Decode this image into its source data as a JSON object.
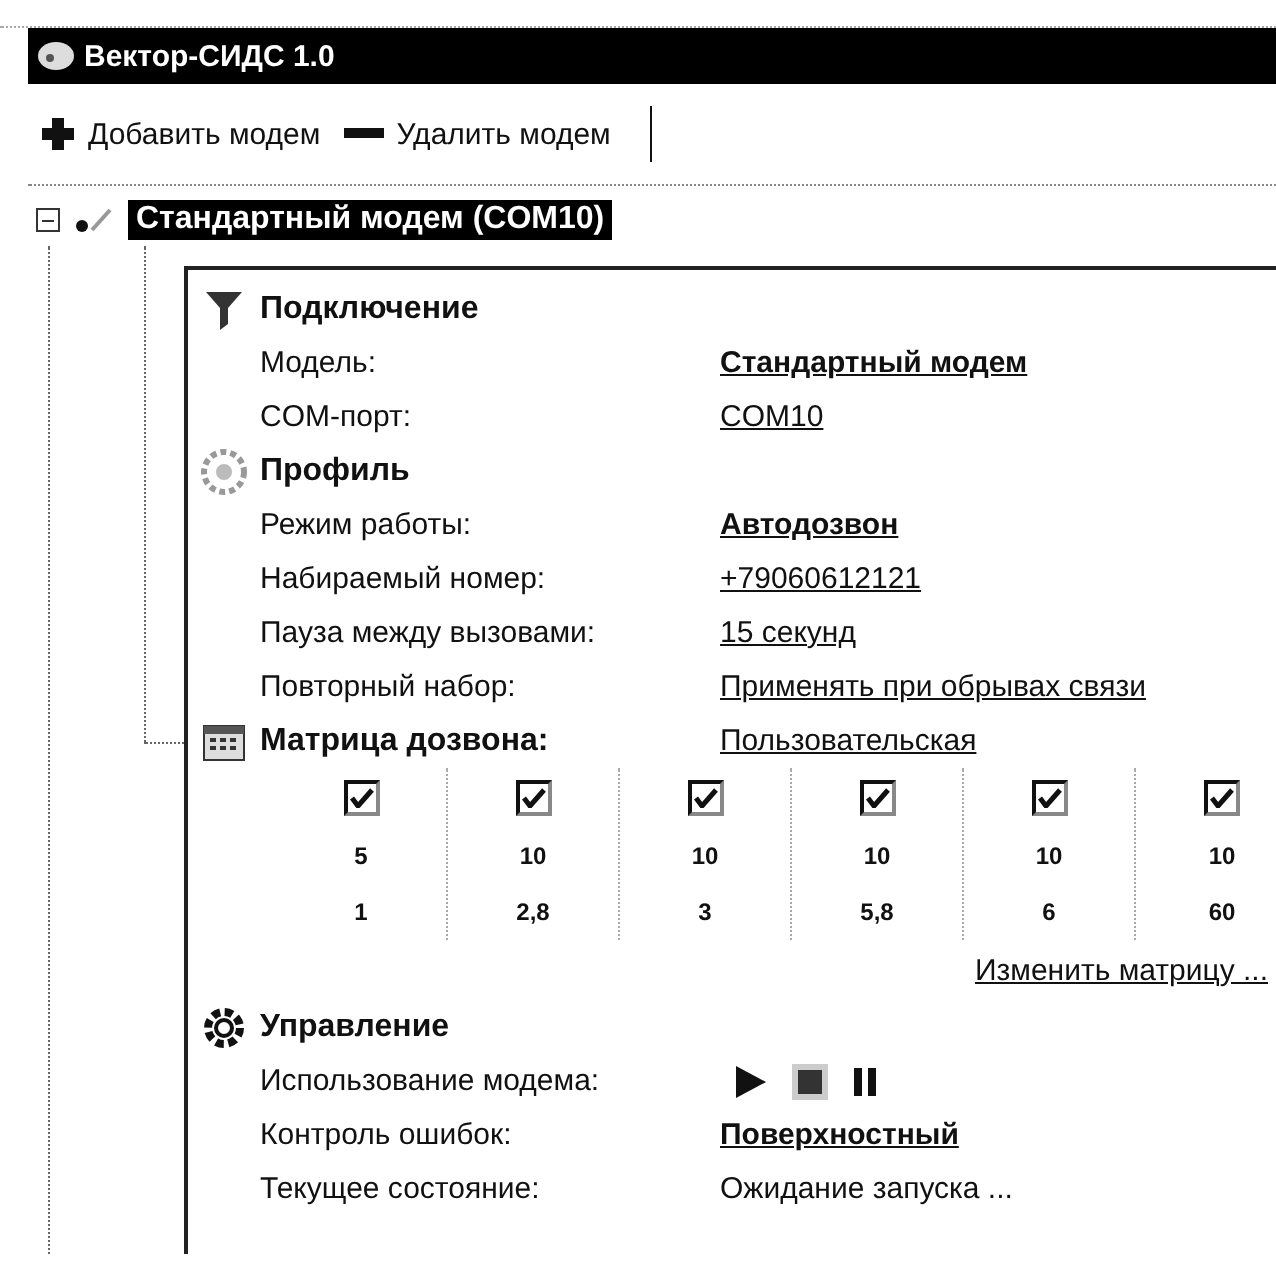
{
  "window": {
    "title": "Вектор-СИДС 1.0"
  },
  "toolbar": [
    {
      "label": "Добавить модем",
      "kind": "add"
    },
    {
      "label": "Удалить модем",
      "kind": "remove"
    }
  ],
  "tree": {
    "label": "Стандартный модем (COM10)",
    "selected": true,
    "expanded": true
  },
  "sections": [
    {
      "title": "Подключение",
      "kind": "connection",
      "rows": [
        {
          "label": "Модель:",
          "kind": "link",
          "value": "Стандартный модем",
          "bold": true
        },
        {
          "label": "COM-порт:",
          "kind": "link",
          "value": "COM10",
          "bold": false
        }
      ]
    },
    {
      "title": "Профиль",
      "kind": "profile",
      "rows": [
        {
          "label": "Режим работы:",
          "kind": "link",
          "value": "Автодозвон",
          "bold": true
        },
        {
          "label": "Набираемый номер:",
          "kind": "link",
          "value": "+79060612121",
          "bold": false
        },
        {
          "label": "Пауза между вызовами:",
          "kind": "link",
          "value": "15 секунд",
          "bold": false
        },
        {
          "label": "Повторный набор:",
          "kind": "link",
          "value": "Применять при обрывах связи",
          "bold": false
        }
      ]
    },
    {
      "title": "Матрица дозвона:",
      "kind": "matrix",
      "value": "Пользовательская",
      "matrix": [
        {
          "checked": true,
          "count": "5",
          "interval": "1"
        },
        {
          "checked": true,
          "count": "10",
          "interval": "2,8"
        },
        {
          "checked": true,
          "count": "10",
          "interval": "3"
        },
        {
          "checked": true,
          "count": "10",
          "interval": "5,8"
        },
        {
          "checked": true,
          "count": "10",
          "interval": "6"
        },
        {
          "checked": true,
          "count": "10",
          "interval": "60"
        }
      ],
      "action": "Изменить матрицу ..."
    },
    {
      "title": "Управление",
      "kind": "control",
      "rows": [
        {
          "label": "Использование модема:",
          "kind": "media",
          "buttons": [
            {
              "kind": "play"
            },
            {
              "kind": "stop"
            },
            {
              "kind": "pause"
            }
          ]
        },
        {
          "label": "Контроль ошибок:",
          "kind": "link",
          "value": "Поверхностный",
          "bold": true
        },
        {
          "label": "Текущее состояние:",
          "kind": "text",
          "value": "Ожидание запуска ...",
          "bold": false
        }
      ]
    }
  ]
}
